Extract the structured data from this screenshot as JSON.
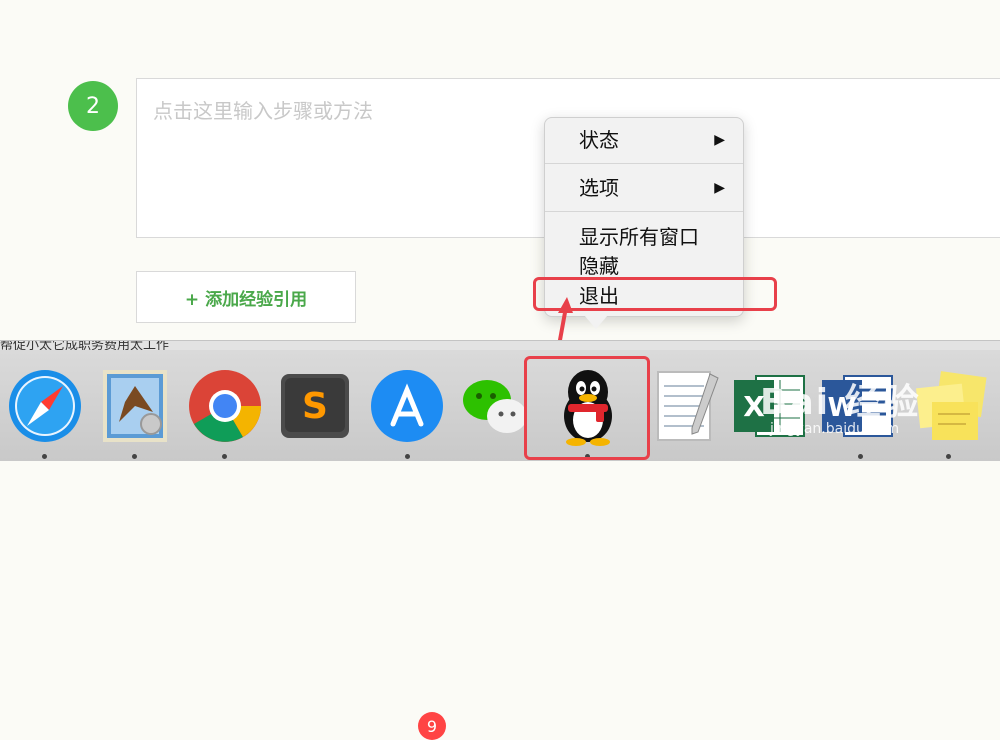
{
  "editor": {
    "step_number": "2",
    "placeholder": "点击这里输入步骤或方法",
    "add_reference_label": "+ 添加经验引用"
  },
  "context_menu": {
    "items": [
      {
        "label": "状态",
        "submenu": true
      },
      {
        "label": "选项",
        "submenu": true
      },
      {
        "label": "显示所有窗口",
        "submenu": false
      },
      {
        "label": "隐藏",
        "submenu": false
      },
      {
        "label": "退出",
        "submenu": false
      }
    ],
    "submenu_arrow": "▶"
  },
  "dock": {
    "background_text": "帮促小太它成职务费用太工作",
    "apps": [
      {
        "name": "Safari",
        "icon": "safari-icon"
      },
      {
        "name": "Mail",
        "icon": "mail-icon"
      },
      {
        "name": "Google Chrome",
        "icon": "chrome-icon"
      },
      {
        "name": "Sublime Text",
        "icon": "sublime-icon"
      },
      {
        "name": "App Store",
        "icon": "appstore-icon",
        "badge": "9"
      },
      {
        "name": "WeChat",
        "icon": "wechat-icon"
      },
      {
        "name": "QQ",
        "icon": "qq-icon"
      },
      {
        "name": "TextEdit",
        "icon": "textedit-icon"
      },
      {
        "name": "Excel",
        "icon": "excel-icon"
      },
      {
        "name": "Word",
        "icon": "word-icon"
      },
      {
        "name": "Stickies",
        "icon": "stickies-icon"
      }
    ]
  },
  "watermark": {
    "brand": "Bai 经验",
    "url": "jingyan.baidu.com"
  },
  "colors": {
    "accent_green": "#4cbf4c",
    "highlight_red": "#e8404a"
  }
}
